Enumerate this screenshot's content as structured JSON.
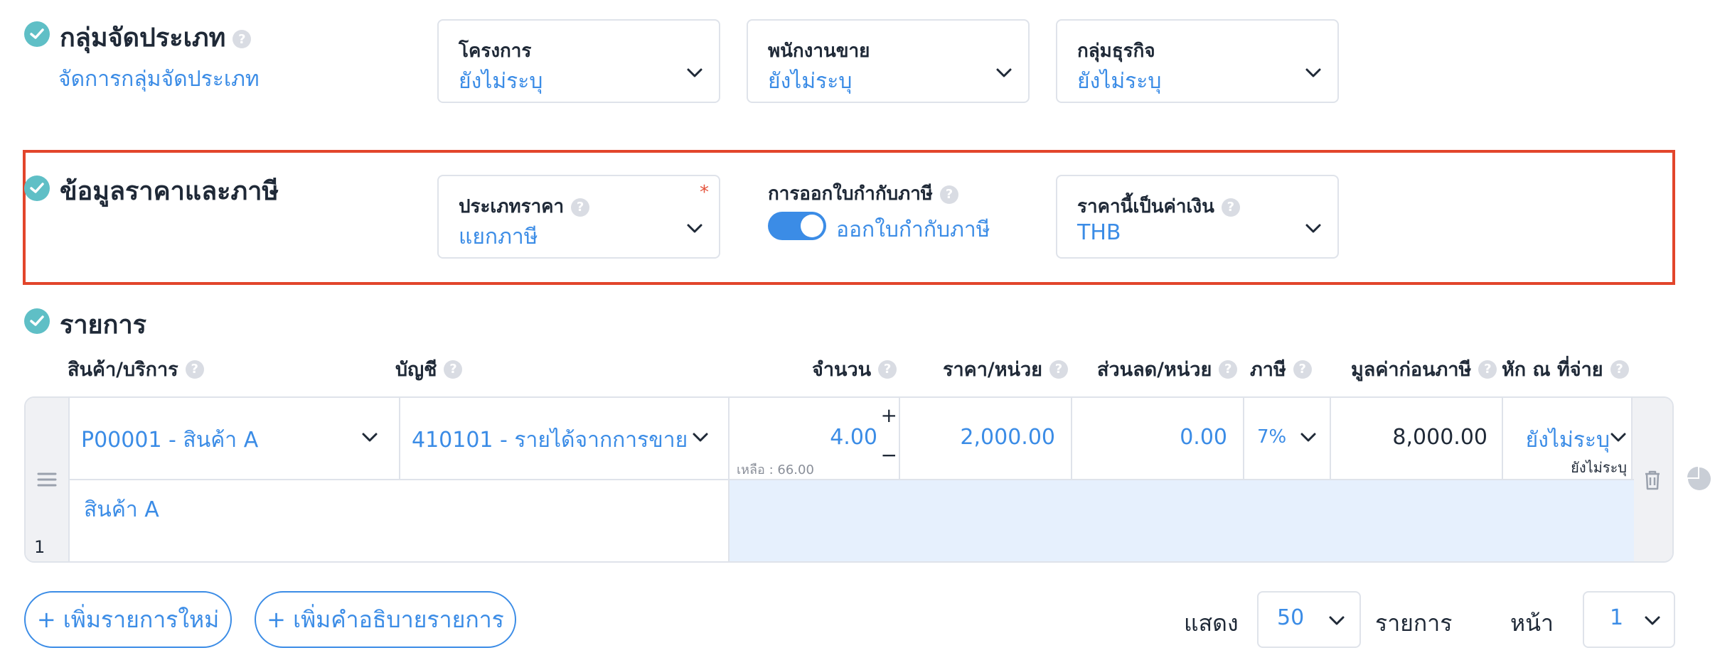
{
  "sections": {
    "classification": {
      "title": "กลุ่มจัดประเภท",
      "manage_link": "จัดการกลุ่มจัดประเภท",
      "fields": [
        {
          "label": "โครงการ",
          "value": "ยังไม่ระบุ"
        },
        {
          "label": "พนักงานขาย",
          "value": "ยังไม่ระบุ"
        },
        {
          "label": "กลุ่มธุรกิจ",
          "value": "ยังไม่ระบุ"
        }
      ]
    },
    "pricing": {
      "title": "ข้อมูลราคาและภาษี",
      "price_type": {
        "label": "ประเภทราคา",
        "value": "แยกภาษี",
        "required_mark": "*"
      },
      "tax_invoice": {
        "label": "การออกใบกำกับภาษี",
        "toggle_label": "ออกใบกำกับภาษี",
        "enabled": true
      },
      "currency": {
        "label": "ราคานี้เป็นค่าเงิน",
        "value": "THB"
      }
    },
    "items": {
      "title": "รายการ",
      "columns": [
        "สินค้า/บริการ",
        "บัญชี",
        "จำนวน",
        "ราคา/หน่วย",
        "ส่วนลด/หน่วย",
        "ภาษี",
        "มูลค่าก่อนภาษี",
        "หัก ณ ที่จ่าย"
      ],
      "row": {
        "index": "1",
        "product": "P00001 - สินค้า A",
        "account": "410101 - รายได้จากการขาย...",
        "quantity": "4.00",
        "remaining": "เหลือ : 66.00",
        "unit_price": "2,000.00",
        "discount": "0.00",
        "tax": "7%",
        "pre_tax": "8,000.00",
        "withholding": "ยังไม่ระบุ",
        "withholding_sub": "ยังไม่ระบุ",
        "description": "สินค้า A",
        "plus": "+",
        "minus": "−"
      }
    }
  },
  "footer": {
    "add_item": "+ เพิ่มรายการใหม่",
    "add_description": "+ เพิ่มคำอธิบายรายการ",
    "show_label": "แสดง",
    "page_size": "50",
    "items_label": "รายการ",
    "page_label": "หน้า",
    "page_number": "1"
  },
  "help_glyph": "?",
  "colors": {
    "accent": "#3b8ce6",
    "check": "#5fbfc6",
    "highlight": "#e2452b",
    "selected_bg": "#e6f0fd"
  }
}
